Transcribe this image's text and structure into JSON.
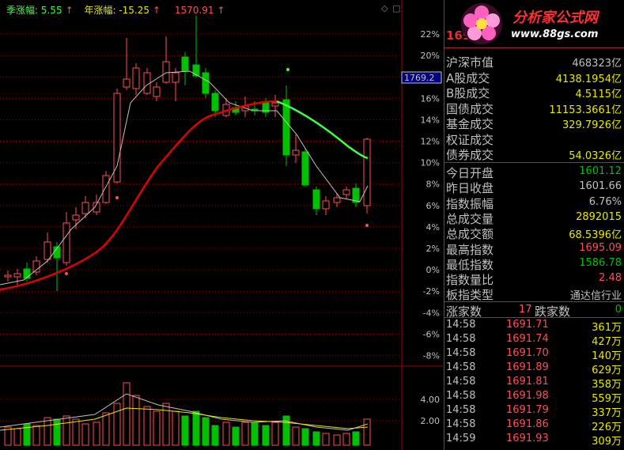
{
  "legend": {
    "season_label": "季涨幅: 5.55",
    "year_label": "年涨幅: -15.25",
    "extra_value": "1570.91"
  },
  "price_axis": {
    "labels": [
      "22%",
      "20%",
      "18%",
      "16%",
      "14%",
      "12%",
      "10%",
      "8%",
      "6%",
      "4%",
      "2%",
      "0%",
      "-2%",
      "-4%",
      "-6%",
      "-8%"
    ],
    "cursor_value": "1769.2"
  },
  "volume_axis": {
    "labels": [
      "4.00",
      "2.00"
    ]
  },
  "colors": {
    "up": "#ff5050",
    "down": "#00c000",
    "ma_red": "#e00000",
    "ma_green": "#40ff40",
    "ma_thin": "#c0c0c0",
    "grid": "#a00000"
  },
  "logo": {
    "code_text": "169",
    "brand": "分析家公式网",
    "url": "www.88gs.com"
  },
  "stats": [
    {
      "label": "沪深市值",
      "value": "468323亿",
      "color": "#c0c0c0"
    },
    {
      "label": "A股成交",
      "value": "4138.1954亿",
      "color": "#e8e800"
    },
    {
      "label": "B股成交",
      "value": "4.5115亿",
      "color": "#e8e800"
    },
    {
      "label": "国债成交",
      "value": "11153.3661亿",
      "color": "#e8e800"
    },
    {
      "label": "基金成交",
      "value": "329.7926亿",
      "color": "#e8e800"
    },
    {
      "label": "权证成交",
      "value": "",
      "color": "#e8e800"
    },
    {
      "label": "债券成交",
      "value": "54.0326亿",
      "color": "#e8e800"
    }
  ],
  "index_stats": [
    {
      "label": "今日开盘",
      "value": "1601.12",
      "color": "#00c000"
    },
    {
      "label": "昨日收盘",
      "value": "1601.66",
      "color": "#c0c0c0"
    },
    {
      "label": "指数振幅",
      "value": "6.76%",
      "color": "#c0c0c0"
    },
    {
      "label": "总成交量",
      "value": "2892015",
      "color": "#e8e800"
    },
    {
      "label": "总成交额",
      "value": "68.5396亿",
      "color": "#e8e800"
    },
    {
      "label": "最高指数",
      "value": "1695.09",
      "color": "#ff5050"
    },
    {
      "label": "最低指数",
      "value": "1586.78",
      "color": "#00c000"
    },
    {
      "label": "指数量比",
      "value": "2.48",
      "color": "#ff5050"
    },
    {
      "label": "板指类型",
      "value": "通达信行业",
      "color": "#c0c0c0"
    }
  ],
  "updown": {
    "up_label": "涨家数",
    "up_value": "17",
    "down_label": "跌家数",
    "down_value": "0"
  },
  "ticks": [
    {
      "time": "14:58",
      "price": "1691.71",
      "vol": "361",
      "unit": "万"
    },
    {
      "time": "14:58",
      "price": "1691.74",
      "vol": "427",
      "unit": "万"
    },
    {
      "time": "14:58",
      "price": "1691.70",
      "vol": "140",
      "unit": "万"
    },
    {
      "time": "14:58",
      "price": "1691.89",
      "vol": "629",
      "unit": "万"
    },
    {
      "time": "14:58",
      "price": "1691.81",
      "vol": "358",
      "unit": "万"
    },
    {
      "time": "14:58",
      "price": "1691.98",
      "vol": "559",
      "unit": "万"
    },
    {
      "time": "14:58",
      "price": "1691.79",
      "vol": "337",
      "unit": "万"
    },
    {
      "time": "14:58",
      "price": "1691.86",
      "vol": "226",
      "unit": "万"
    },
    {
      "time": "14:59",
      "price": "1691.93",
      "vol": "309",
      "unit": "万"
    }
  ]
}
